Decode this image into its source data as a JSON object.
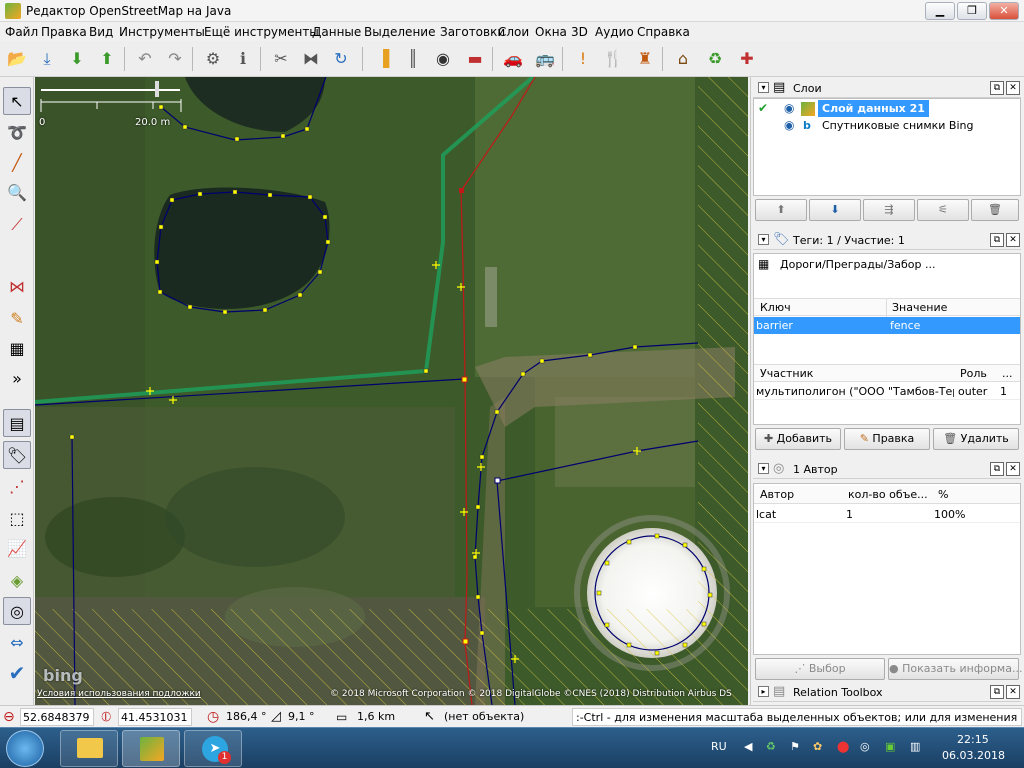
{
  "window": {
    "title": "Редактор OpenStreetMap на Java",
    "minimize": "▁",
    "maximize": "❐",
    "close": "✕"
  },
  "menu": [
    "Файл",
    "Правка",
    "Вид",
    "Инструменты",
    "Ещё инструменты",
    "Данные",
    "Выделение",
    "Заготовки",
    "Слои",
    "Окна",
    "3D",
    "Аудио",
    "Справка"
  ],
  "toolbar_icons": [
    "open-icon",
    "download-icon",
    "download-data-icon",
    "upload-icon",
    "undo-icon",
    "redo-icon",
    "preferences-icon",
    "info-icon",
    "split-icon",
    "combine-icon",
    "refresh-icon",
    "road-icon",
    "railway-icon",
    "traffic-light-icon",
    "barrier-icon",
    "car-icon",
    "bus-icon",
    "warning-icon",
    "restaurant-icon",
    "castle-icon",
    "industrial-icon",
    "recycling-icon",
    "hospital-icon"
  ],
  "map": {
    "scale_left": "0",
    "scale_right": "20.0 m",
    "bing_logo": "bing",
    "terms": "Условия использования подложки",
    "attribution": "© 2018 Microsoft Corporation © 2018 DigitalGlobe ©CNES (2018) Distribution Airbus DS"
  },
  "layers": {
    "title": "Слои",
    "items": [
      {
        "name": "Слой данных 21",
        "selected": true
      },
      {
        "name": "Спутниковые снимки Bing",
        "selected": false
      }
    ]
  },
  "tags": {
    "title": "Теги: 1 / Участие: 1",
    "preset": "Дороги/Преграды/Забор ...",
    "col_key": "Ключ",
    "col_value": "Значение",
    "rows": [
      {
        "key": "barrier",
        "value": "fence"
      }
    ],
    "rel_col_member": "Участник",
    "rel_col_role": "Роль",
    "rel_col_more": "...",
    "relations": [
      {
        "member": "мультиполигон (\"ООО \"Тамбов-Терм...",
        "role": "outer",
        "pos": "1"
      }
    ],
    "btn_add": "Добавить",
    "btn_edit": "Правка",
    "btn_delete": "Удалить"
  },
  "authors": {
    "title": "1 Автор",
    "col_author": "Автор",
    "col_count": "кол-во объе...",
    "col_percent": "%",
    "rows": [
      {
        "author": "lcat",
        "count": "1",
        "percent": "100%"
      }
    ],
    "btn_select": "Выбор",
    "btn_info": "Показать информа..."
  },
  "relation_toolbox": {
    "title": "Relation Toolbox"
  },
  "status": {
    "lat": "52.6848379",
    "lon": "41.4531031",
    "heading": "186,4 °",
    "angle": "9,1 °",
    "distance": "1,6 km",
    "object": "(нет объекта)",
    "hint": ":-Ctrl - для изменения масштаба выделенных объектов; или для изменения выделения"
  },
  "taskbar": {
    "lang": "RU",
    "time": "22:15",
    "date": "06.03.2018",
    "telegram_badge": "1"
  },
  "colors": {
    "accent": "#3399ff",
    "way_blue": "#00006e",
    "way_green": "#1f9e5a",
    "node_yellow": "#ffff00"
  }
}
